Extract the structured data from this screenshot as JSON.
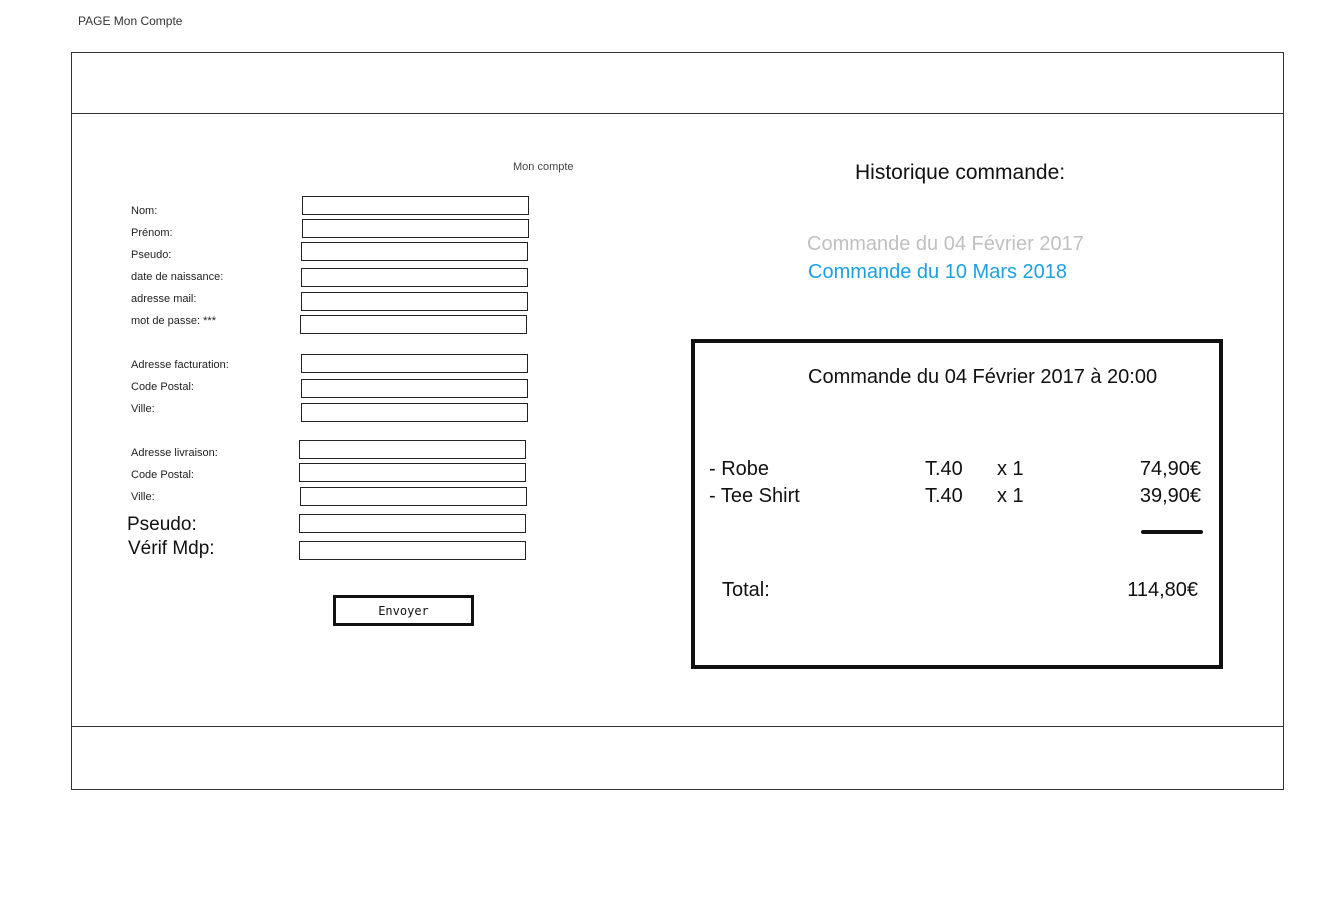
{
  "page_label": "PAGE Mon Compte",
  "form": {
    "title": "Mon compte",
    "fields": {
      "nom": "Nom:",
      "prenom": "Prénom:",
      "pseudo": "Pseudo:",
      "naissance": "date de naissance:",
      "email": "adresse mail:",
      "password": "mot de passe: ***",
      "adresse_facturation": "Adresse facturation:",
      "code_postal_facturation": "Code Postal:",
      "ville_facturation": "Ville:",
      "adresse_livraison": "Adresse livraison:",
      "code_postal_livraison": "Code Postal:",
      "ville_livraison": "Ville:",
      "pseudo_confirm": "Pseudo:",
      "verif_mdp": "Vérif Mdp:"
    },
    "submit_label": "Envoyer"
  },
  "history": {
    "title": "Historique commande:",
    "orders": [
      {
        "label": "Commande du 04 Février 2017",
        "color": "#c0c0c0"
      },
      {
        "label": "Commande du 10 Mars 2018",
        "color": "#1ba1e2"
      }
    ]
  },
  "order_detail": {
    "title": "Commande du 04 Février 2017  à 20:00",
    "items": [
      {
        "name": "- Robe",
        "size": "T.40",
        "qty": "x 1",
        "price": "74,90€"
      },
      {
        "name": "- Tee Shirt",
        "size": "T.40",
        "qty": "x 1",
        "price": "39,90€"
      }
    ],
    "total_label": "Total:",
    "total_value": "114,80€"
  }
}
